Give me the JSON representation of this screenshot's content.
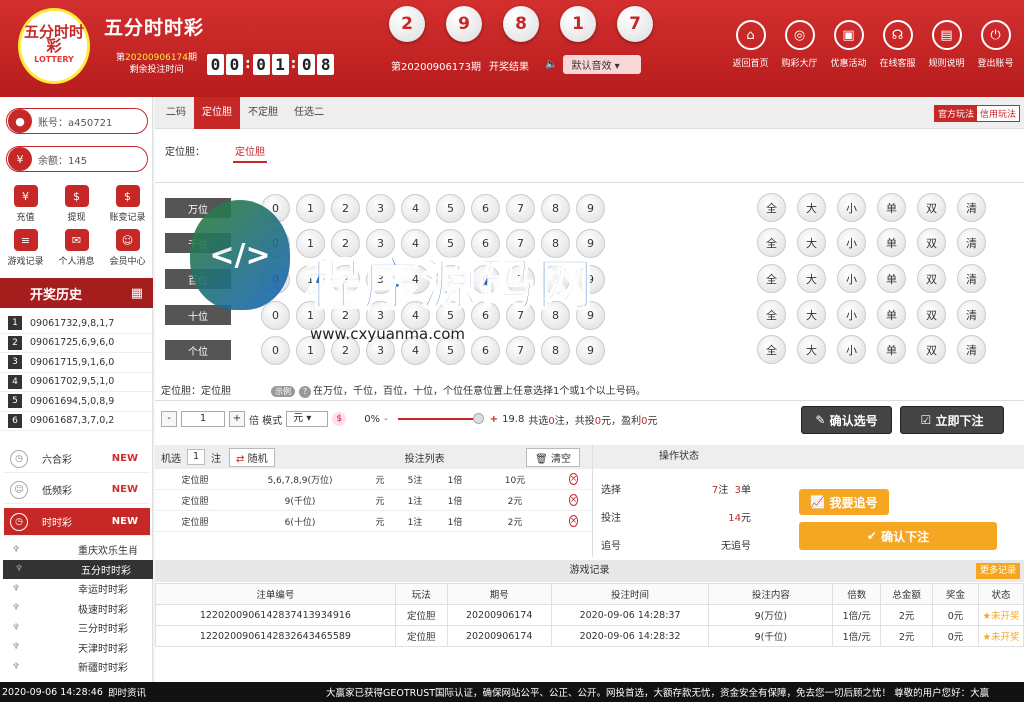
{
  "header": {
    "logo_text": "五分时时彩",
    "logo_sub": "LOTTERY",
    "brand": "五分时时彩",
    "issue_prefix": "第",
    "issue_number": "20200906174",
    "issue_suffix": "期",
    "issue_sub": "剩余投注时间",
    "countdown": [
      "0",
      "0",
      "0",
      "1",
      "0",
      "8"
    ],
    "last_balls": [
      "2",
      "9",
      "8",
      "1",
      "7"
    ],
    "last_issue_text": "第20200906173期",
    "draw_label": "开奖结果",
    "sound_value": "默认音效",
    "nav": [
      {
        "label": "返回首页",
        "icon": "home-icon",
        "glyph": "⌂"
      },
      {
        "label": "购彩大厅",
        "icon": "lottery-hall-icon",
        "glyph": "◎"
      },
      {
        "label": "优惠活动",
        "icon": "promo-icon",
        "glyph": "▣"
      },
      {
        "label": "在线客服",
        "icon": "headset-icon",
        "glyph": "☊"
      },
      {
        "label": "规则说明",
        "icon": "rules-icon",
        "glyph": "▤"
      },
      {
        "label": "登出账号",
        "icon": "power-icon",
        "glyph": "⏻"
      }
    ]
  },
  "sidebar": {
    "account": "账号：a450721",
    "balance": "余额：145",
    "quick": [
      {
        "label": "充值",
        "glyph": "¥"
      },
      {
        "label": "提现",
        "glyph": "$"
      },
      {
        "label": "账变记录",
        "glyph": "$"
      },
      {
        "label": "游戏记录",
        "glyph": "≡"
      },
      {
        "label": "个人消息",
        "glyph": "✉"
      },
      {
        "label": "会员中心",
        "glyph": "☺"
      }
    ],
    "history_title": "开奖历史",
    "history": [
      {
        "n": "1",
        "issue": "0906173",
        "result": "2,9,8,1,7"
      },
      {
        "n": "2",
        "issue": "0906172",
        "result": "5,6,9,6,0"
      },
      {
        "n": "3",
        "issue": "0906171",
        "result": "5,9,1,6,0"
      },
      {
        "n": "4",
        "issue": "0906170",
        "result": "2,9,5,1,0"
      },
      {
        "n": "5",
        "issue": "0906169",
        "result": "4,5,0,8,9"
      },
      {
        "n": "6",
        "issue": "0906168",
        "result": "7,3,7,0,2"
      }
    ],
    "games": [
      {
        "label": "六合彩",
        "badge": "NEW"
      },
      {
        "label": "低频彩",
        "badge": "NEW"
      },
      {
        "label": "时时彩",
        "badge": "NEW"
      }
    ],
    "sub_games": [
      "重庆欢乐生肖",
      "五分时时彩",
      "幸运时时彩",
      "极速时时彩",
      "三分时时彩",
      "天津时时彩",
      "新疆时时彩"
    ]
  },
  "main": {
    "tabs": [
      "二码",
      "定位胆",
      "不定胆",
      "任选二"
    ],
    "modes": [
      "官方玩法",
      "信用玩法"
    ],
    "sub_label": "定位胆：",
    "sub_tab": "定位胆",
    "positions": [
      "万位",
      "千位",
      "百位",
      "十位",
      "个位"
    ],
    "digits": [
      "0",
      "1",
      "2",
      "3",
      "4",
      "5",
      "6",
      "7",
      "8",
      "9"
    ],
    "quick_select": [
      "全",
      "大",
      "小",
      "单",
      "双",
      "清"
    ],
    "tip_label": "定位胆：定位胆",
    "tip_example": "示例",
    "tip_text": "在万位，千位，百位，十位，个位任意位置上任意选择1个或1个以上号码。",
    "multiple": "1",
    "multiple_label": "倍 模式",
    "unit": "元",
    "percent": "0%",
    "rebate": "19.8",
    "summary": [
      "共选",
      "0",
      "注，共投",
      "0",
      "元，盈利",
      "0",
      "元"
    ],
    "confirm_select": "确认选号",
    "bet_now": "立即下注"
  },
  "cart": {
    "random_label": "机选",
    "random_count": "1",
    "unit_label": "注",
    "random_btn": "随机",
    "list_title": "投注列表",
    "clear": "清空",
    "rows": [
      {
        "play": "定位胆",
        "content": "5,6,7,8,9(万位)",
        "unit": "元",
        "bets": "5注",
        "mult": "1倍",
        "amount": "10元"
      },
      {
        "play": "定位胆",
        "content": "9(千位)",
        "unit": "元",
        "bets": "1注",
        "mult": "1倍",
        "amount": "2元"
      },
      {
        "play": "定位胆",
        "content": "6(十位)",
        "unit": "元",
        "bets": "1注",
        "mult": "1倍",
        "amount": "2元"
      }
    ]
  },
  "status": {
    "title": "操作状态",
    "select_label": "选择",
    "select_bets": "7",
    "select_bets_unit": "注",
    "select_orders": "3",
    "select_orders_unit": "单",
    "bet_label": "投注",
    "bet_value": "14",
    "bet_unit": "元",
    "chase_label": "追号",
    "chase_value": "无追号",
    "chase_btn": "我要追号",
    "confirm_btn": "确认下注"
  },
  "records": {
    "title": "游戏记录",
    "more": "更多记录",
    "headers": [
      "注单编号",
      "玩法",
      "期号",
      "投注时间",
      "投注内容",
      "倍数",
      "总金额",
      "奖金",
      "状态"
    ],
    "rows": [
      [
        "12202009061428374139349​16",
        "定位胆",
        "20200906174",
        "2020-09-06 14:28:37",
        "9(万位)",
        "1倍/元",
        "2元",
        "0元",
        "未开奖"
      ],
      [
        "122020090614283264346558​9",
        "定位胆",
        "20200906174",
        "2020-09-06 14:28:32",
        "9(千位)",
        "1倍/元",
        "2元",
        "0元",
        "未开奖"
      ]
    ]
  },
  "footer": {
    "time": "2020-09-06 14:28:46",
    "news_label": "即时资讯",
    "news": "大赢家已获得GEOTRUST国际认证，确保网站公平、公正、公开。网投首选，大额存款无忧，资金安全有保障，免去您一切后顾之忧！      尊敬的用户您好：大赢"
  },
  "watermark": {
    "title": "程序源码网",
    "url": "www.cxyuanma.com"
  },
  "colors": {
    "primary": "#c62828",
    "accent": "#f5a623",
    "dark": "#333333"
  }
}
